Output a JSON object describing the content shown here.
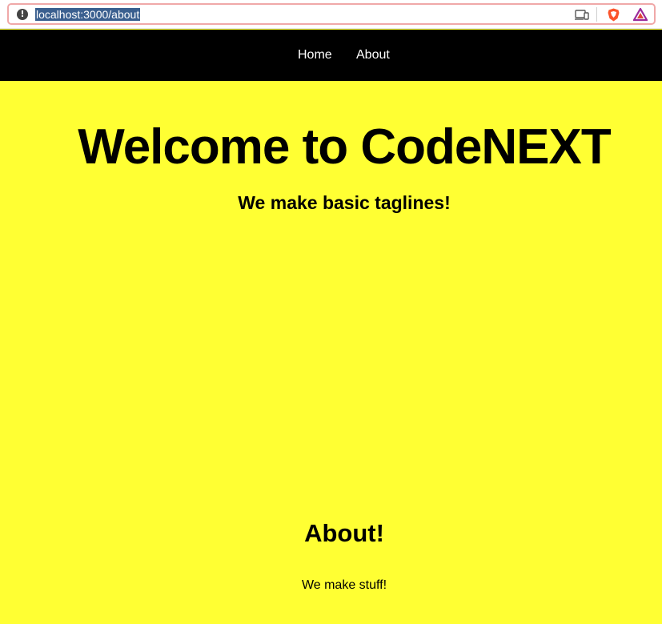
{
  "browser": {
    "url": "localhost:3000/about",
    "info_icon": "info-icon",
    "icons": [
      "cast-icon",
      "brave-shield-icon",
      "brave-rewards-icon"
    ]
  },
  "nav": {
    "items": [
      {
        "label": "Home"
      },
      {
        "label": "About"
      }
    ]
  },
  "hero": {
    "title": "Welcome to CodeNEXT",
    "tagline": "We make basic taglines!"
  },
  "about": {
    "heading": "About!",
    "body": "We make stuff!"
  },
  "colors": {
    "page_background": "#ffff33",
    "nav_background": "#000000",
    "nav_text": "#ffffff",
    "url_highlight": "#3a5f8f",
    "address_border": "#f0a8a8"
  }
}
